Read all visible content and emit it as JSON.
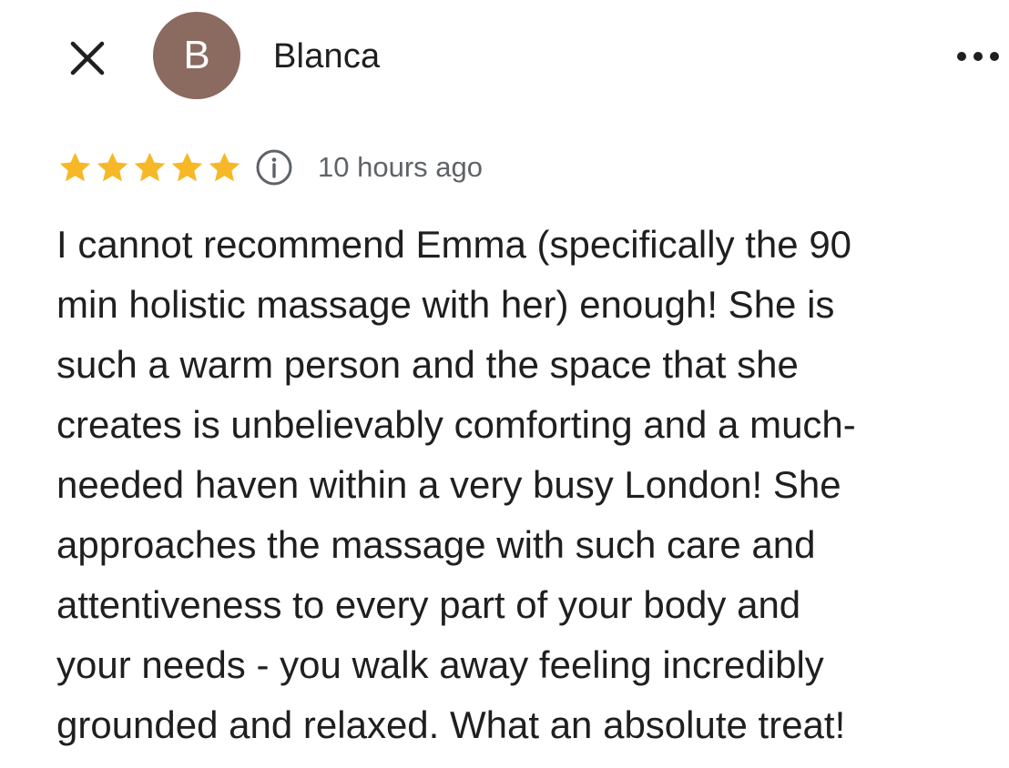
{
  "header": {
    "close_icon": "close-icon",
    "avatar_letter": "B",
    "avatar_color": "#8b6a5f",
    "reviewer_name": "Blanca",
    "more_icon": "more-horizontal-icon"
  },
  "review": {
    "rating": 5,
    "rating_max": 5,
    "star_color": "#f6b826",
    "info_icon": "info-icon",
    "timestamp": "10 hours ago",
    "text": "I cannot recommend Emma (specifically the 90\nmin holistic massage with her) enough! She is\nsuch a warm person and the space that she\ncreates is unbelievably comforting and a much-\nneeded haven within a very busy London! She\napproaches the massage with such care and\nattentiveness to every part of your body and\nyour needs - you walk away feeling incredibly\ngrounded and relaxed. What an absolute treat!"
  }
}
